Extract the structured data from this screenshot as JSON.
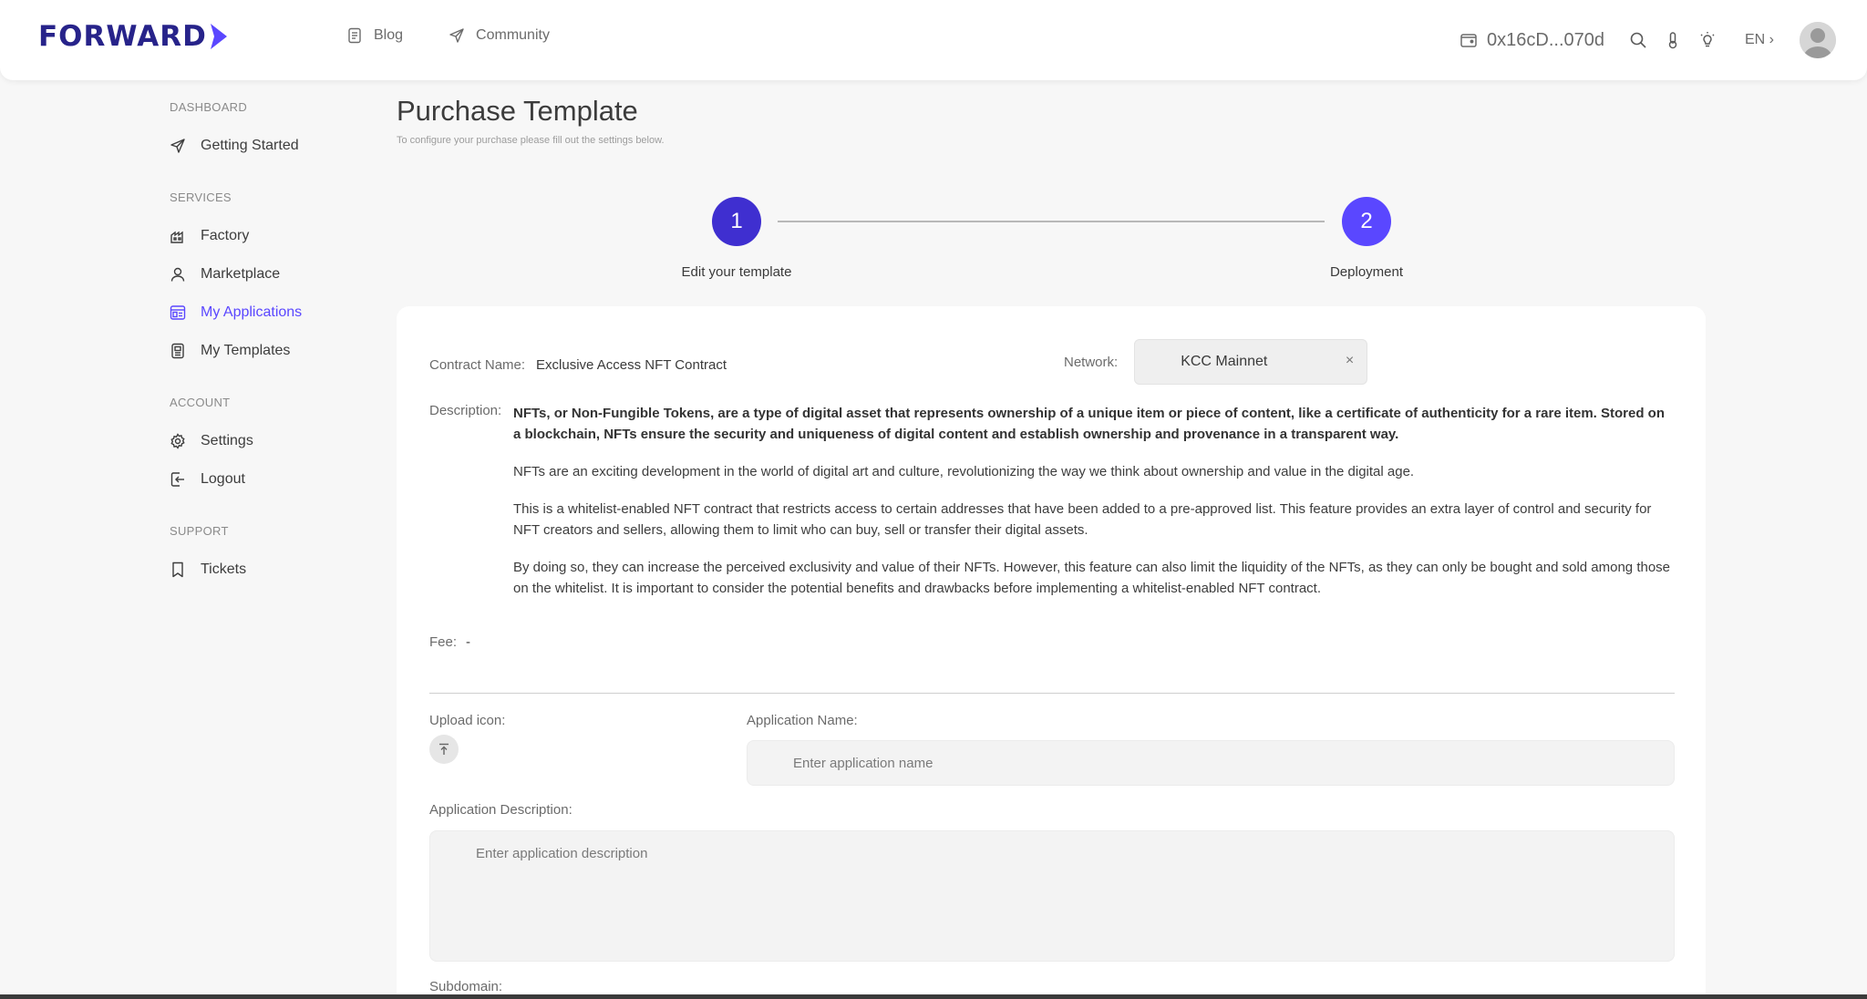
{
  "header": {
    "logo": "FORWARD",
    "nav": [
      {
        "label": "Blog",
        "icon": "document-icon"
      },
      {
        "label": "Community",
        "icon": "paper-plane-icon"
      }
    ],
    "wallet": "0x16cD...070d",
    "language": "EN ›"
  },
  "sidebar": {
    "sections": [
      {
        "title": "DASHBOARD",
        "items": [
          {
            "label": "Getting Started",
            "icon": "paper-plane-icon"
          }
        ]
      },
      {
        "title": "SERVICES",
        "items": [
          {
            "label": "Factory",
            "icon": "factory-icon"
          },
          {
            "label": "Marketplace",
            "icon": "user-icon"
          },
          {
            "label": "My Applications",
            "icon": "applications-icon",
            "active": true
          },
          {
            "label": "My Templates",
            "icon": "template-icon"
          }
        ]
      },
      {
        "title": "ACCOUNT",
        "items": [
          {
            "label": "Settings",
            "icon": "gear-icon"
          },
          {
            "label": "Logout",
            "icon": "logout-icon"
          }
        ]
      },
      {
        "title": "SUPPORT",
        "items": [
          {
            "label": "Tickets",
            "icon": "bookmark-icon"
          }
        ]
      }
    ]
  },
  "page": {
    "title": "Purchase Template",
    "subtitle": "To configure your purchase please fill out the settings below."
  },
  "stepper": {
    "steps": [
      {
        "number": "1",
        "label": "Edit your template",
        "color": "#3f2fd0"
      },
      {
        "number": "2",
        "label": "Deployment",
        "color": "#5a47ff"
      }
    ]
  },
  "form": {
    "contract_label": "Contract Name:",
    "contract_value": "Exclusive Access NFT Contract",
    "network_label": "Network:",
    "network_value": "KCC Mainnet",
    "network_clear": "×",
    "description_label": "Description:",
    "description": [
      "NFTs, or Non-Fungible Tokens, are a type of digital asset that represents ownership of a unique item or piece of content, like a certificate of authenticity for a rare item. Stored on a blockchain, NFTs ensure the security and uniqueness of digital content and establish ownership and provenance in a transparent way.",
      "NFTs are an exciting development in the world of digital art and culture, revolutionizing the way we think about ownership and value in the digital age.",
      "This is a whitelist-enabled NFT contract that restricts access to certain addresses that have been added to a pre-approved list. This feature provides an extra layer of control and security for NFT creators and sellers, allowing them to limit who can buy, sell or transfer their digital assets.",
      "By doing so, they can increase the perceived exclusivity and value of their NFTs. However, this feature can also limit the liquidity of the NFTs, as they can only be bought and sold among those on the whitelist. It is important to consider the potential benefits and drawbacks before implementing a whitelist-enabled NFT contract."
    ],
    "fee_label": "Fee:",
    "fee_value": "-",
    "upload_label": "Upload icon:",
    "app_name_label": "Application Name:",
    "app_name_placeholder": "Enter application name",
    "app_desc_label": "Application Description:",
    "app_desc_placeholder": "Enter application description",
    "subdomain_label": "Subdomain:"
  }
}
